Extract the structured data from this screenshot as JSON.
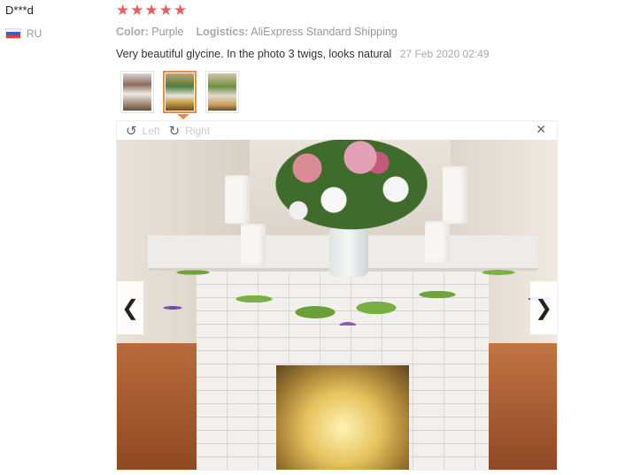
{
  "review": {
    "user_name": "D***d",
    "country_code": "RU",
    "rating_stars": 5,
    "color_label": "Color:",
    "color_value": "Purple",
    "logistics_label": "Logistics:",
    "logistics_value": "AliExpress Standard Shipping",
    "text": "Very beautiful glycine. In the photo 3 twigs, looks natural",
    "date": "27 Feb 2020 02:49"
  },
  "thumbnails": [
    {
      "name": "photo-1",
      "active": false
    },
    {
      "name": "photo-2",
      "active": true
    },
    {
      "name": "photo-3",
      "active": false
    }
  ],
  "viewer": {
    "rotate_left_label": "Left",
    "rotate_right_label": "Right",
    "icons": {
      "rotate_left": "rotate-left-icon",
      "rotate_right": "rotate-right-icon",
      "close": "close-icon",
      "prev": "chevron-left-icon",
      "next": "chevron-right-icon"
    }
  },
  "colors": {
    "star": "#f25b5b",
    "active_thumb_border": "#f08a3e",
    "muted_text": "#999999"
  }
}
